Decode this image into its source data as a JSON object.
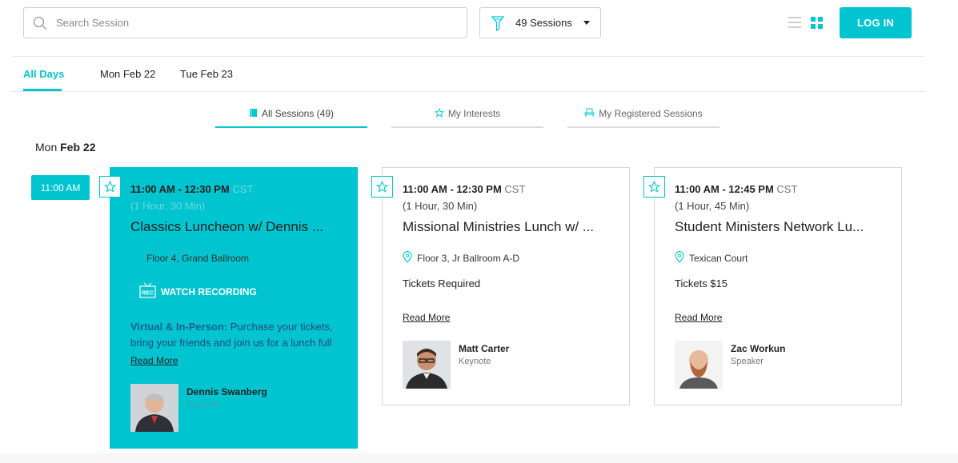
{
  "search": {
    "placeholder": "Search Session",
    "icon": "search-icon"
  },
  "filter": {
    "label": "49 Sessions",
    "icon": "filter-icon"
  },
  "view": {
    "list_icon": "list-view-icon",
    "grid_icon": "grid-view-icon"
  },
  "login": {
    "label": "LOG IN"
  },
  "accent": "#00c4cf",
  "days": [
    {
      "label": "All Days",
      "active": true
    },
    {
      "label": "Mon Feb 22"
    },
    {
      "label": "Tue Feb 23"
    }
  ],
  "session_tabs": [
    {
      "label": "All Sessions (49)",
      "icon": "book-icon",
      "active": true
    },
    {
      "label": "My Interests",
      "icon": "star-icon"
    },
    {
      "label": "My Registered Sessions",
      "icon": "chair-icon"
    }
  ],
  "day_heading": {
    "weekday": "Mon",
    "date": "Feb 22"
  },
  "time_slot": "11:00 AM",
  "cards": [
    {
      "time": "11:00 AM - 12:30 PM",
      "tz": "CST",
      "duration": "(1 Hour, 30 Min)",
      "title": "Classics Luncheon w/ Dennis ...",
      "location": "Floor 4, Grand Ballroom",
      "watch_label": "WATCH RECORDING",
      "watch_badge": "REC",
      "desc_lead": "Virtual & In-Person:",
      "desc_text": " Purchase your tickets, bring your friends and join us for a lunch full",
      "read_more": "Read More",
      "speaker_name": "Dennis Swanberg",
      "speaker_role": "Keynote"
    },
    {
      "time": "11:00 AM - 12:30 PM",
      "tz": "CST",
      "duration": "(1 Hour, 30 Min)",
      "title": "Missional Ministries Lunch w/ ...",
      "location": "Floor 3, Jr Ballroom A-D",
      "tickets": "Tickets Required",
      "read_more": "Read More",
      "speaker_name": "Matt Carter",
      "speaker_role": "Keynote"
    },
    {
      "time": "11:00 AM - 12:45 PM",
      "tz": "CST",
      "duration": "(1 Hour, 45 Min)",
      "title": "Student Ministers Network Lu...",
      "location": "Texican Court",
      "tickets": "Tickets $15",
      "read_more": "Read More",
      "speaker_name": "Zac Workun",
      "speaker_role": "Speaker"
    }
  ]
}
